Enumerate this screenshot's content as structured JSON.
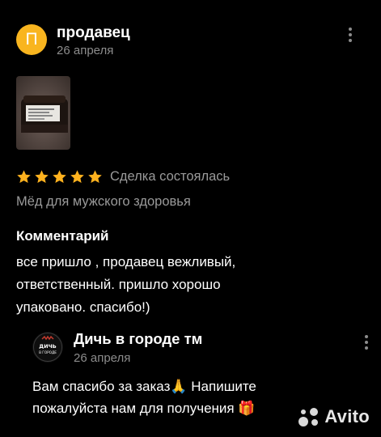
{
  "review": {
    "author_initial": "П",
    "author_name": "продавец",
    "date": "26 апреля",
    "rating": 5,
    "deal_status": "Сделка состоялась",
    "item_title": "Мёд для мужского здоровья",
    "comment_label": "Комментарий",
    "comment_lines": [
      "все пришло , продавец вежливый,",
      "ответственный. пришло хорошо",
      "упаковано. спасибо!)"
    ]
  },
  "reply": {
    "avatar_text_top": "ДИЧЬ",
    "avatar_text_bottom": "В ГОРОДЕ",
    "author_name": "Дичь в городе тм",
    "date": "26 апреля",
    "text_lines": [
      "Вам спасибо за заказ🙏 Напишите",
      "пожалуйста нам для получения 🎁"
    ]
  },
  "watermark": {
    "text": "Avito"
  },
  "colors": {
    "avatar": "#f9b51f",
    "star": "#ffb21e",
    "secondary_text": "#8c8c8c",
    "background": "#000000"
  },
  "icons": [
    "more-vertical-icon",
    "star-icon",
    "avito-logo-icon"
  ]
}
